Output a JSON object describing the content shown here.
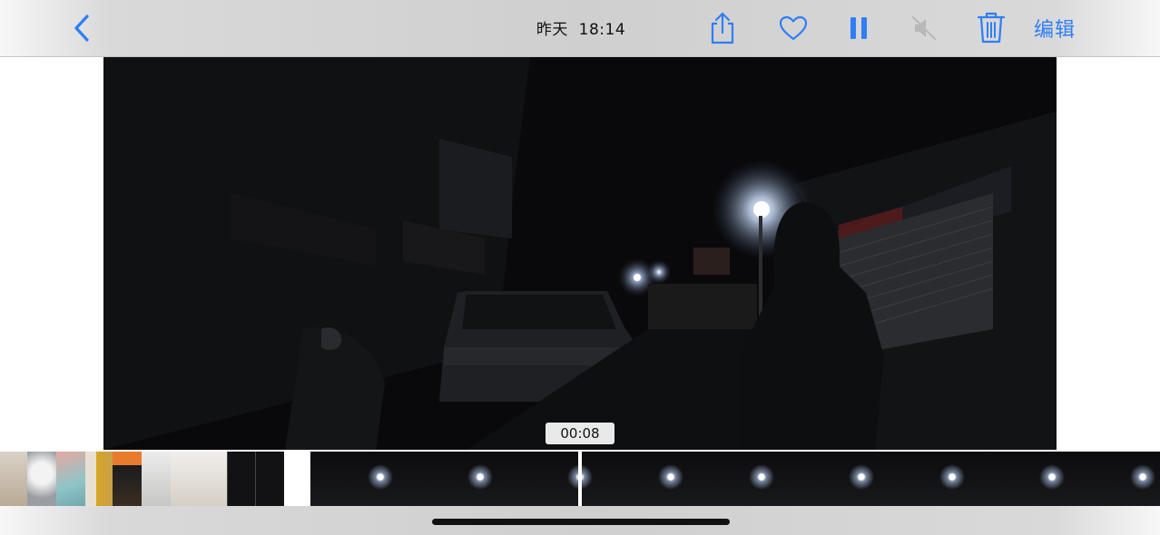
{
  "toolbar": {
    "back_icon": "chevron-left-icon",
    "title": "昨天  18:14",
    "share_icon": "share-icon",
    "favorite_icon": "heart-icon",
    "pause_icon": "pause-icon",
    "mute_icon": "speaker-muted-icon",
    "delete_icon": "trash-icon",
    "edit_label": "编辑"
  },
  "video": {
    "current_time": "00:08"
  },
  "colors": {
    "accent": "#2f7ef5",
    "toolbar_bg": "#d2d2d2",
    "video_bg": "#0b0b0d"
  }
}
